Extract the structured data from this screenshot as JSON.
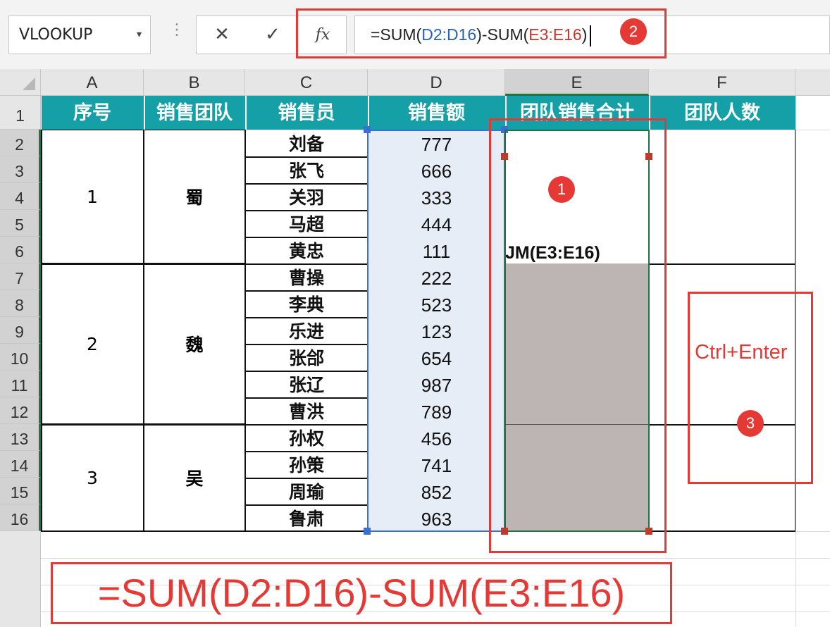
{
  "formula_bar": {
    "name_box": "VLOOKUP",
    "name_box_arrow": "▾",
    "separator": "⋮",
    "cancel_icon": "✕",
    "enter_icon": "✓",
    "fx_icon": "fx",
    "formula_parts": [
      "=SUM(",
      "D2:D16",
      ")-SUM(",
      "E3:E16",
      ")"
    ]
  },
  "columns": [
    "A",
    "B",
    "C",
    "D",
    "E",
    "F"
  ],
  "rows": [
    "1",
    "2",
    "3",
    "4",
    "5",
    "6",
    "7",
    "8",
    "9",
    "10",
    "11",
    "12",
    "13",
    "14",
    "15",
    "16"
  ],
  "headers": [
    "序号",
    "销售团队",
    "销售员",
    "销售额",
    "团队销售合计",
    "团队人数"
  ],
  "groups": [
    {
      "no": "1",
      "team": "蜀"
    },
    {
      "no": "2",
      "team": "魏"
    },
    {
      "no": "3",
      "team": "吴"
    }
  ],
  "salespeople": [
    "刘备",
    "张飞",
    "关羽",
    "马超",
    "黄忠",
    "曹操",
    "李典",
    "乐进",
    "张郃",
    "张辽",
    "曹洪",
    "孙权",
    "孙策",
    "周瑜",
    "鲁肃"
  ],
  "sales": [
    "777",
    "666",
    "333",
    "444",
    "111",
    "222",
    "523",
    "123",
    "654",
    "987",
    "789",
    "456",
    "741",
    "852",
    "963"
  ],
  "editing_text": "JM(E3:E16)",
  "annotations": {
    "badge1": "1",
    "badge2": "2",
    "badge3": "3",
    "ctrl_enter": "Ctrl+Enter",
    "big_formula": "=SUM(D2:D16)-SUM(E3:E16)"
  },
  "colors": {
    "header_teal": "#14a0a6",
    "annotation_red": "#e53935",
    "selection_green": "#217346",
    "ref_blue": "#2a5fb8"
  }
}
